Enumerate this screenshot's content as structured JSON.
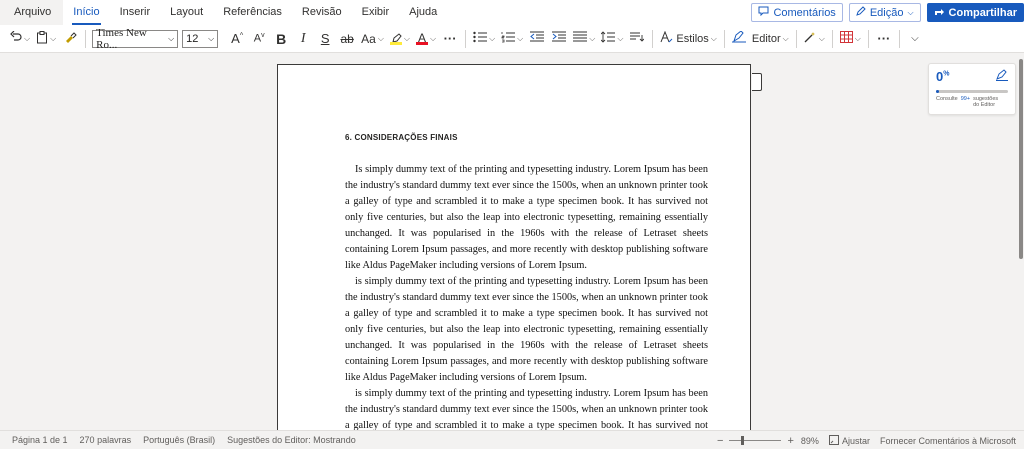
{
  "tabs": [
    "Arquivo",
    "Início",
    "Inserir",
    "Layout",
    "Referências",
    "Revisão",
    "Exibir",
    "Ajuda"
  ],
  "active_tab_index": 1,
  "topbar": {
    "comments_label": "Comentários",
    "edit_label": "Edição",
    "share_label": "Compartilhar"
  },
  "ribbon": {
    "font_name": "Times New Ro...",
    "font_size": "12",
    "change_case_label": "Aa",
    "styles_label": "Estilos",
    "editor_label": "Editor"
  },
  "document": {
    "heading": "6. CONSIDERAÇÕES FINAIS",
    "paragraphs": [
      "Is simply dummy text of the printing and typesetting industry. Lorem Ipsum has been the industry's standard dummy text ever since the 1500s, when an unknown printer took a galley of type and scrambled it to make a type specimen book. It has survived not only five centuries, but also the leap into electronic typesetting, remaining essentially unchanged. It was popularised in the 1960s with the release of Letraset sheets containing Lorem Ipsum passages, and more recently with desktop publishing software like Aldus PageMaker including versions of Lorem Ipsum.",
      "is simply dummy text of the printing and typesetting industry. Lorem Ipsum has been the industry's standard dummy text ever since the 1500s, when an unknown printer took a galley of type and scrambled it to make a type specimen book. It has survived not only five centuries, but also the leap into electronic typesetting, remaining essentially unchanged. It was popularised in the 1960s with the release of Letraset sheets containing Lorem Ipsum passages, and more recently with desktop publishing software like Aldus PageMaker including versions of Lorem Ipsum.",
      "is simply dummy text of the printing and typesetting industry. Lorem Ipsum has been the industry's standard dummy text ever since the 1500s, when an unknown printer took a galley of type and scrambled it to make a type specimen book. It has survived not only five centuries, but also the leap into electronic typesetting, remaining essentially unchanged."
    ]
  },
  "editor_pane": {
    "score": "0",
    "score_unit": "%",
    "consult_label": "Consulte",
    "suggestion_count": "99+",
    "suggestions_label": "sugestões do Editor"
  },
  "status": {
    "page": "Página 1 de 1",
    "words": "270 palavras",
    "language": "Português (Brasil)",
    "editor_suggestions": "Sugestões do Editor: Mostrando",
    "zoom": "89%",
    "fit_label": "Ajustar",
    "feedback_label": "Fornecer Comentários à Microsoft"
  },
  "colors": {
    "accent": "#185abd",
    "highlight": "#ffeb3b",
    "font_color": "#e81123"
  }
}
